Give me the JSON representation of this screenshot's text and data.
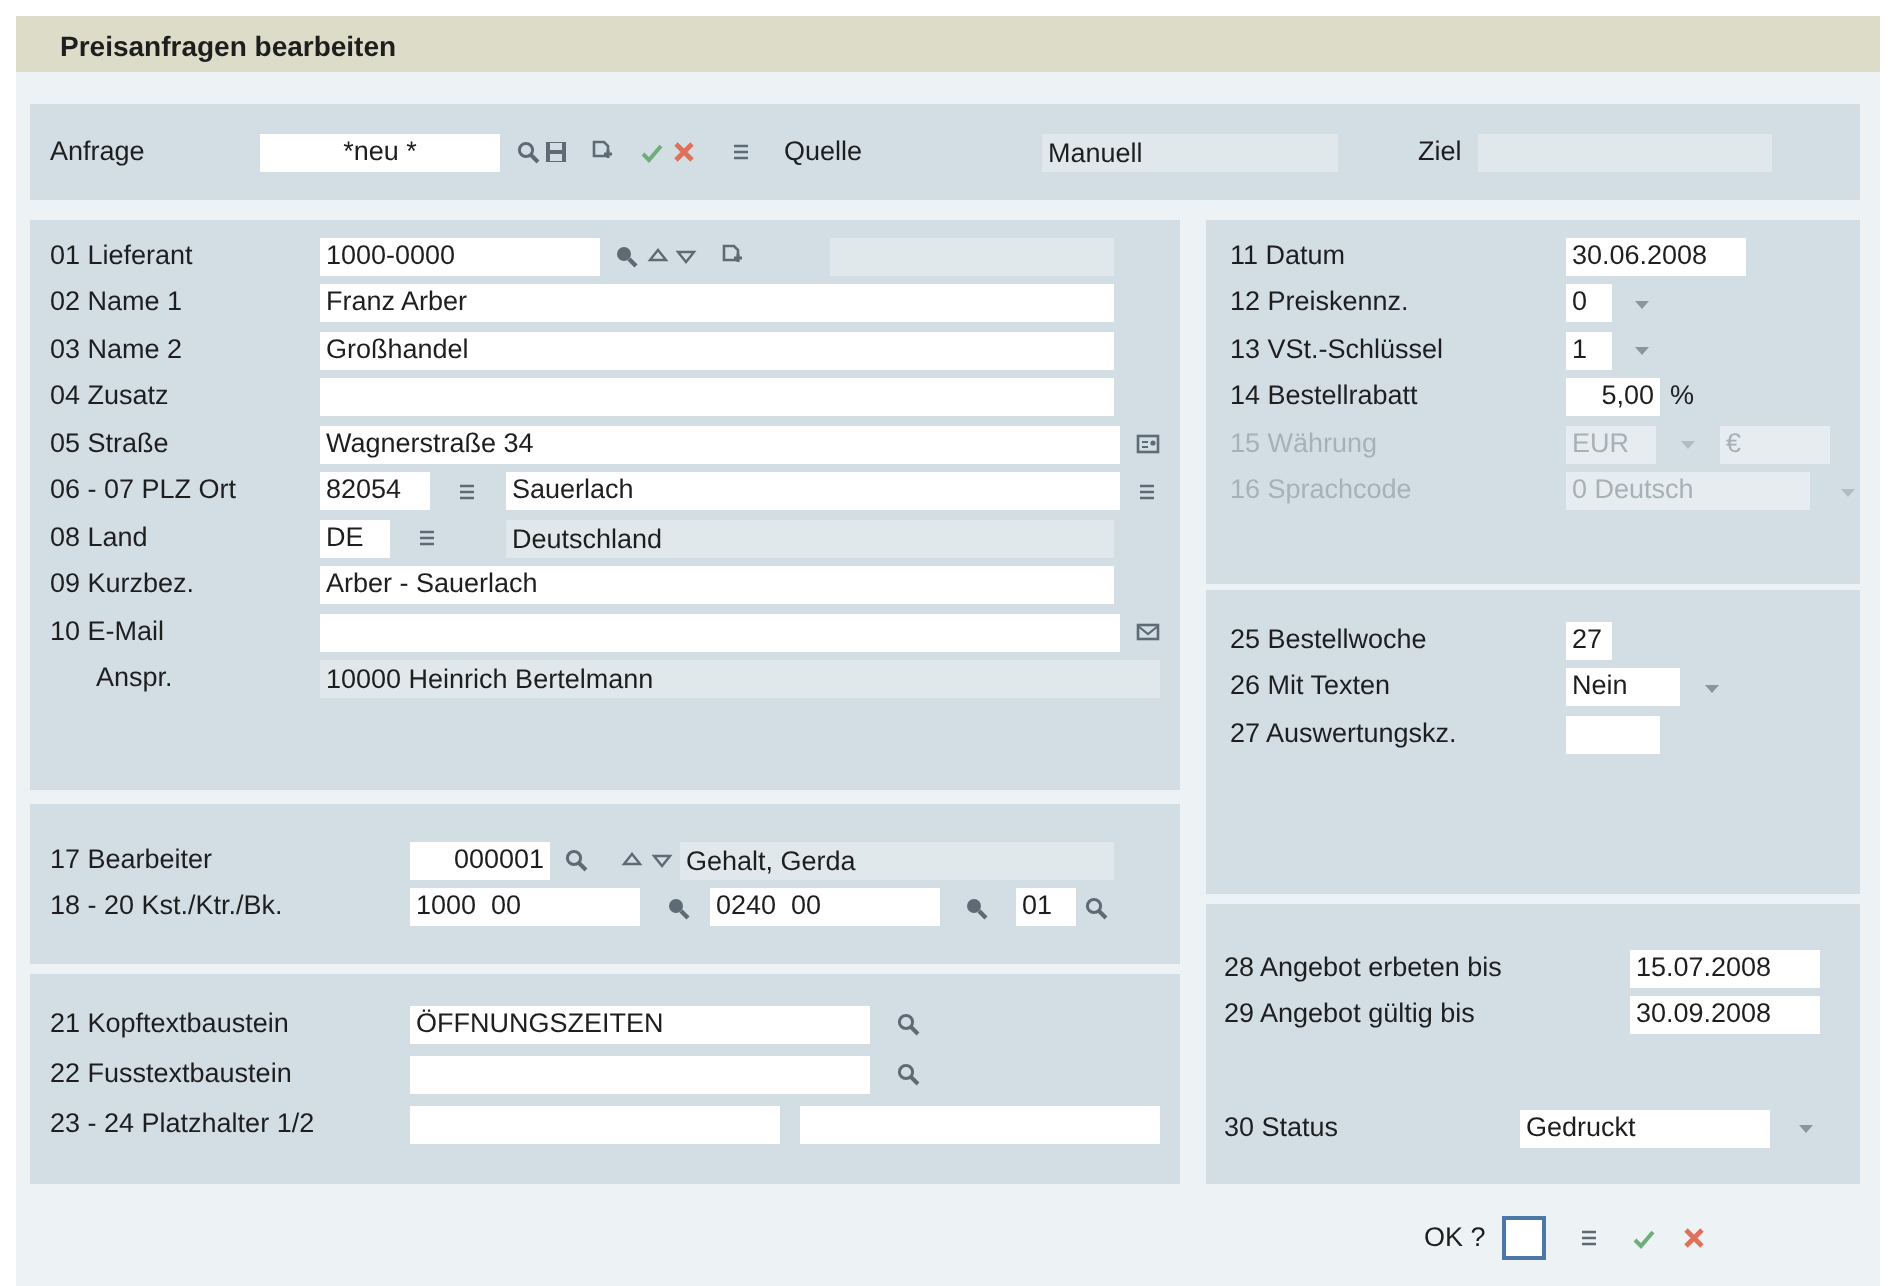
{
  "window": {
    "title": "Preisanfragen bearbeiten"
  },
  "header": {
    "label": "Anfrage",
    "controls": [
      {
        "kind": "field",
        "value": "*neu *"
      },
      {
        "kind": "lookup"
      },
      {
        "kind": "save"
      },
      {
        "kind": "new"
      },
      {
        "kind": "confirm"
      },
      {
        "kind": "cancel"
      },
      {
        "kind": "list"
      },
      {
        "kind": "label",
        "text": "Quelle"
      },
      {
        "kind": "display",
        "value": "Manuell"
      },
      {
        "kind": "label",
        "text": "Ziel"
      },
      {
        "kind": "display"
      }
    ]
  },
  "left_sections": [
    {
      "rows": [
        {
          "label": "01 Lieferant",
          "controls": [
            {
              "kind": "field",
              "value": "1000-0000"
            },
            {
              "kind": "lookup_alt"
            },
            {
              "kind": "up"
            },
            {
              "kind": "down"
            },
            {
              "kind": "new"
            },
            {
              "kind": "display"
            }
          ]
        },
        {
          "label": "02 Name 1",
          "controls": [
            {
              "kind": "field",
              "value": "Franz Arber"
            }
          ]
        },
        {
          "label": "03 Name 2",
          "controls": [
            {
              "kind": "field",
              "value": "Großhandel"
            }
          ]
        },
        {
          "label": "04 Zusatz",
          "controls": [
            {
              "kind": "field"
            }
          ]
        },
        {
          "label": "05 Straße",
          "controls": [
            {
              "kind": "field",
              "value": "Wagnerstraße 34"
            },
            {
              "kind": "address"
            }
          ]
        },
        {
          "label": "06 - 07 PLZ Ort",
          "controls": [
            {
              "kind": "field",
              "value": "82054"
            },
            {
              "kind": "list"
            },
            {
              "kind": "field",
              "value": "Sauerlach"
            },
            {
              "kind": "list"
            }
          ]
        },
        {
          "label": "08 Land",
          "controls": [
            {
              "kind": "field",
              "value": "DE"
            },
            {
              "kind": "list"
            },
            {
              "kind": "display",
              "value": "Deutschland"
            }
          ]
        },
        {
          "label": "09 Kurzbez.",
          "controls": [
            {
              "kind": "field",
              "value": "Arber - Sauerlach"
            }
          ]
        },
        {
          "label": "10 E-Mail",
          "controls": [
            {
              "kind": "field"
            },
            {
              "kind": "email"
            }
          ]
        },
        {
          "label": "Anspr.",
          "controls": [
            {
              "kind": "display",
              "value": "10000 Heinrich Bertelmann"
            }
          ]
        }
      ]
    },
    {
      "rows": [
        {
          "label": "17 Bearbeiter",
          "controls": [
            {
              "kind": "field",
              "value": "000001"
            },
            {
              "kind": "lookup"
            },
            {
              "kind": "up"
            },
            {
              "kind": "down"
            },
            {
              "kind": "display",
              "value": "Gehalt, Gerda"
            }
          ]
        },
        {
          "label": "18 - 20 Kst./Ktr./Bk.",
          "controls": [
            {
              "kind": "field",
              "value": "1000  00"
            },
            {
              "kind": "lookup_alt"
            },
            {
              "kind": "field",
              "value": "0240  00"
            },
            {
              "kind": "lookup_alt"
            },
            {
              "kind": "field",
              "value": "01"
            },
            {
              "kind": "lookup"
            }
          ]
        }
      ]
    },
    {
      "rows": [
        {
          "label": "21 Kopftextbaustein",
          "controls": [
            {
              "kind": "field",
              "value": "ÖFFNUNGSZEITEN"
            },
            {
              "kind": "lookup"
            }
          ]
        },
        {
          "label": "22 Fusstextbaustein",
          "controls": [
            {
              "kind": "field"
            },
            {
              "kind": "lookup"
            }
          ]
        },
        {
          "label": "23 - 24 Platzhalter 1/2",
          "controls": [
            {
              "kind": "field"
            },
            {
              "kind": "field"
            }
          ]
        }
      ]
    }
  ],
  "right_sections": [
    {
      "rows": [
        {
          "label": "11 Datum",
          "disabled": false,
          "controls": [
            {
              "kind": "field",
              "value": "30.06.2008"
            }
          ]
        },
        {
          "label": "12 Preiskennz.",
          "disabled": false,
          "controls": [
            {
              "kind": "field",
              "value": "0"
            },
            {
              "kind": "dropdown"
            }
          ]
        },
        {
          "label": "13 VSt.-Schlüssel",
          "disabled": false,
          "controls": [
            {
              "kind": "field",
              "value": "1"
            },
            {
              "kind": "dropdown"
            }
          ]
        },
        {
          "label": "14 Bestellrabatt",
          "disabled": false,
          "controls": [
            {
              "kind": "field",
              "value": "5,00"
            },
            {
              "kind": "label",
              "text": "%"
            }
          ]
        },
        {
          "label": "15 Währung",
          "disabled": true,
          "controls": [
            {
              "kind": "field",
              "value": "EUR"
            },
            {
              "kind": "dropdown"
            },
            {
              "kind": "field",
              "value": "€"
            }
          ]
        },
        {
          "label": "16 Sprachcode",
          "disabled": true,
          "controls": [
            {
              "kind": "field",
              "value": "0 Deutsch"
            },
            {
              "kind": "dropdown"
            }
          ]
        }
      ]
    },
    {
      "rows": [
        {
          "label": "25 Bestellwoche",
          "controls": [
            {
              "kind": "field",
              "value": "27"
            }
          ]
        },
        {
          "label": "26 Mit Texten",
          "controls": [
            {
              "kind": "field",
              "value": "Nein"
            },
            {
              "kind": "dropdown"
            }
          ]
        },
        {
          "label": "27 Auswertungskz.",
          "controls": [
            {
              "kind": "field"
            }
          ]
        }
      ]
    },
    {
      "rows": [
        {
          "label": "28 Angebot erbeten bis",
          "controls": [
            {
              "kind": "field",
              "value": "15.07.2008"
            }
          ]
        },
        {
          "label": "29 Angebot gültig bis",
          "controls": [
            {
              "kind": "field",
              "value": "30.09.2008"
            }
          ]
        },
        {
          "label": "30 Status",
          "controls": [
            {
              "kind": "field",
              "value": "Gedruckt"
            },
            {
              "kind": "dropdown"
            }
          ]
        }
      ]
    }
  ],
  "footer": {
    "label": "OK ?",
    "checked": false,
    "controls": [
      {
        "kind": "list"
      },
      {
        "kind": "confirm"
      },
      {
        "kind": "cancel"
      }
    ]
  }
}
